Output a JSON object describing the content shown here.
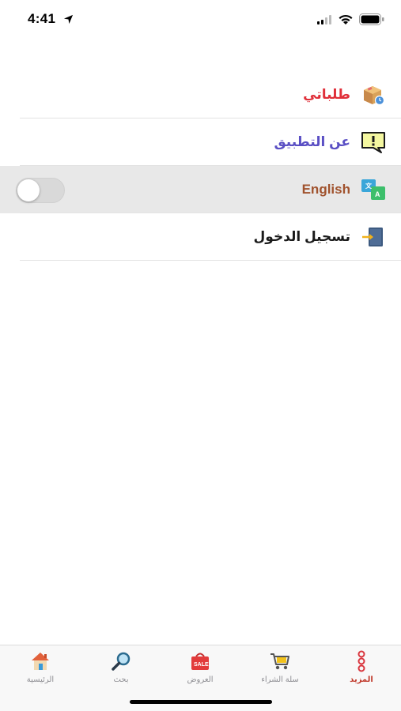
{
  "status": {
    "time": "4:41"
  },
  "menu": {
    "items": [
      {
        "label": "طلباتي",
        "color": "#e0303a",
        "icon": "package-clock-icon"
      },
      {
        "label": "عن التطبيق",
        "color": "#5a4fc4",
        "icon": "info-speech-icon"
      },
      {
        "label": "English",
        "color": "#a0522d",
        "icon": "translate-icon",
        "toggle_on": false
      },
      {
        "label": "تسجيل الدخول",
        "color": "#1a1a1a",
        "icon": "login-door-icon"
      }
    ]
  },
  "tabs": [
    {
      "label": "المزيد",
      "icon": "more-dots-icon",
      "active": true
    },
    {
      "label": "سلة الشراء",
      "icon": "cart-icon",
      "active": false
    },
    {
      "label": "العروض",
      "icon": "sale-bag-icon",
      "active": false
    },
    {
      "label": "بحث",
      "icon": "search-icon",
      "active": false
    },
    {
      "label": "الرئيسية",
      "icon": "home-icon",
      "active": false
    }
  ],
  "colors": {
    "accent": "#c0392b",
    "highlight_row": "#e8e8e8"
  }
}
